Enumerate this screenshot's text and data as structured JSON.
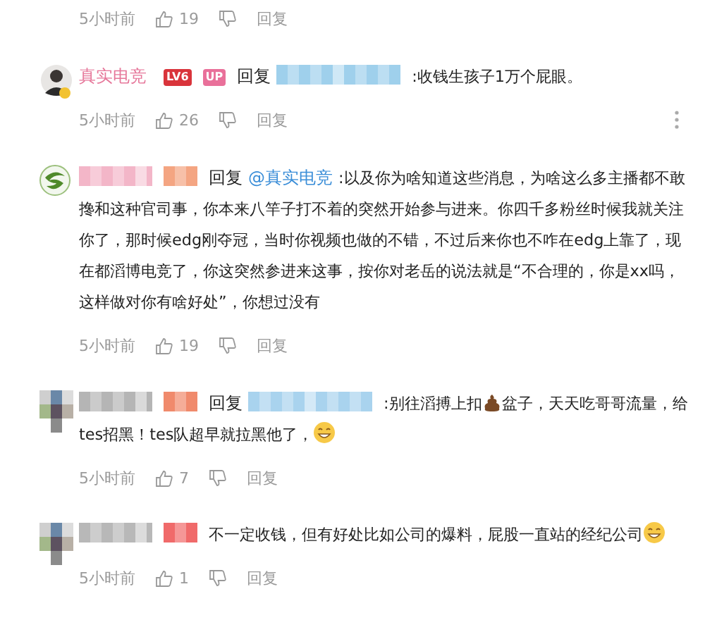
{
  "comments": [
    {
      "footer": {
        "time": "5小时前",
        "likes": "19",
        "reply": "回复"
      }
    },
    {
      "avatar": {
        "kind": "photo"
      },
      "segments": [
        {
          "kind": "user",
          "text": "真实电竞"
        },
        {
          "kind": "badge",
          "text": "LV6",
          "color": "#d9343b"
        },
        {
          "kind": "badge",
          "text": "UP",
          "color": "#e9709a"
        },
        {
          "kind": "reply",
          "text": "回复"
        },
        {
          "kind": "mosaic",
          "color": "#9fd0ec"
        },
        {
          "kind": "text",
          "text": ":收钱生孩子1万个屁眼。"
        }
      ],
      "footer": {
        "time": "5小时前",
        "likes": "26",
        "reply": "回复",
        "more": true
      }
    },
    {
      "avatar": {
        "kind": "logo"
      },
      "segments": [
        {
          "kind": "mosaic",
          "color": "#f3b6c8"
        },
        {
          "kind": "mosaic",
          "color": "#f4a582"
        },
        {
          "kind": "reply",
          "text": "回复"
        },
        {
          "kind": "mention",
          "text": "@真实电竞"
        },
        {
          "kind": "text",
          "text": ":以及你为啥知道这些消息，为啥这么多主播都不敢搀和这种官司事，你本来八竿子打不着的突然开始参与进来。你四千多粉丝时候我就关注你了，那时候edg刚夺冠，当时你视频也做的不错，不过后来你也不咋在edg上靠了，现在都滔博电竞了，你这突然参进来这事，按你对老岳的说法就是“不合理的，你是xx吗，这样做对你有啥好处”，你想过没有"
        }
      ],
      "footer": {
        "time": "5小时前",
        "likes": "19",
        "reply": "回复"
      }
    },
    {
      "avatar": {
        "kind": "mosaic"
      },
      "segments": [
        {
          "kind": "mosaic",
          "color": "#b5b5b5"
        },
        {
          "kind": "mosaic",
          "color": "#f08a6c"
        },
        {
          "kind": "reply",
          "text": "回复"
        },
        {
          "kind": "mosaic",
          "color": "#a9d3ee"
        },
        {
          "kind": "text",
          "text": ":别往滔搏上扣"
        },
        {
          "kind": "poop_icon"
        },
        {
          "kind": "text",
          "text": "盆子，天天吃哥哥流量，给tes招黑！tes队超早就拉黑他了，"
        },
        {
          "kind": "grin_icon"
        }
      ],
      "footer": {
        "time": "5小时前",
        "likes": "7",
        "reply": "回复"
      }
    },
    {
      "avatar": {
        "kind": "mosaic"
      },
      "segments": [
        {
          "kind": "mosaic",
          "color": "#b8b8b8"
        },
        {
          "kind": "mosaic",
          "color": "#f06a6a"
        },
        {
          "kind": "text",
          "text": "不一定收钱，但有好处比如公司的爆料，屁股一直站的经纪公司"
        },
        {
          "kind": "grin_icon"
        }
      ],
      "footer": {
        "time": "5小时前",
        "likes": "1",
        "reply": "回复"
      }
    }
  ]
}
